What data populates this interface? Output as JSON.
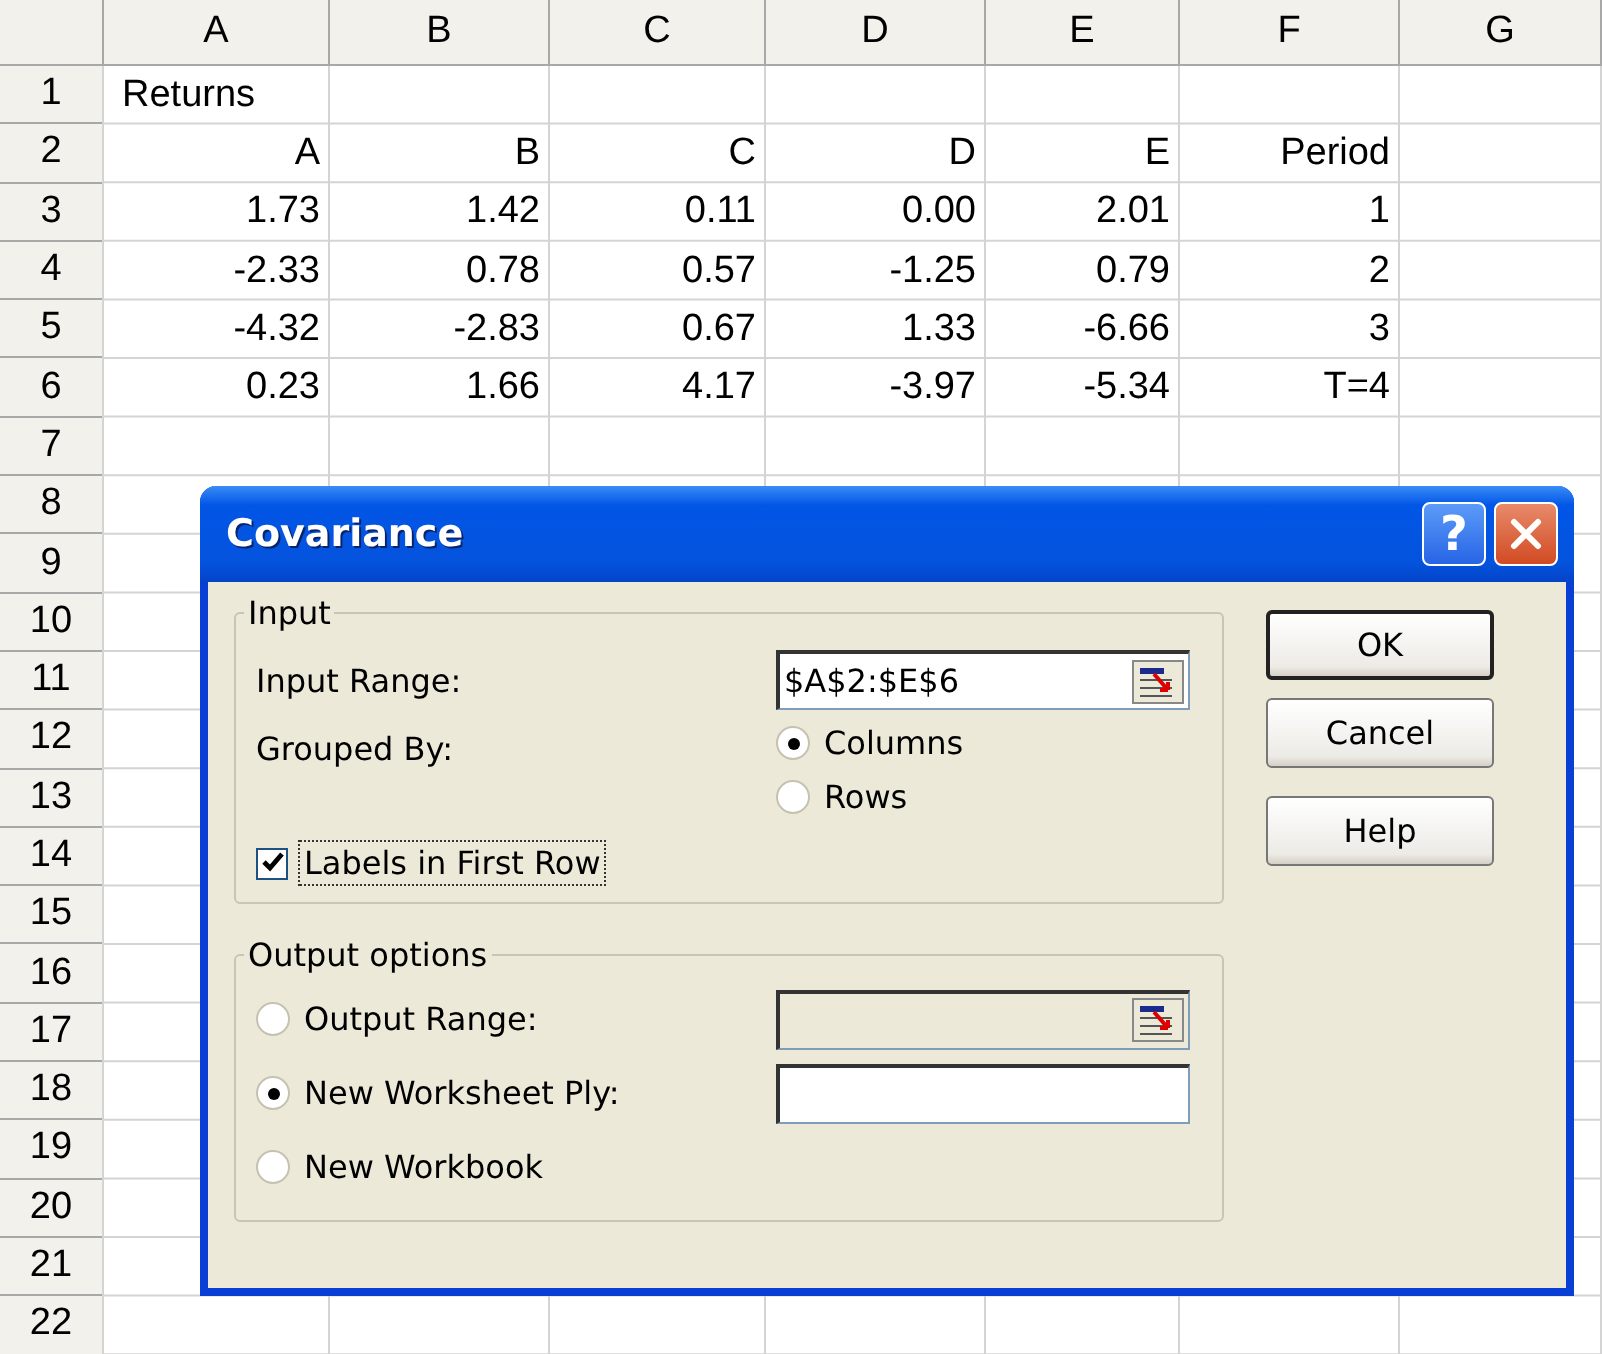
{
  "sheet": {
    "columns": [
      "A",
      "B",
      "C",
      "D",
      "E",
      "F",
      "G"
    ],
    "rows": [
      {
        "number": "1",
        "kind": "label",
        "cells": [
          "Returns"
        ]
      },
      {
        "number": "2",
        "kind": "data",
        "cells": [
          "A",
          "B",
          "C",
          "D",
          "E",
          "Period"
        ]
      },
      {
        "number": "3",
        "kind": "data",
        "cells": [
          "1.73",
          "1.42",
          "0.11",
          "0.00",
          "2.01",
          "1"
        ]
      },
      {
        "number": "4",
        "kind": "data",
        "cells": [
          "-2.33",
          "0.78",
          "0.57",
          "-1.25",
          "0.79",
          "2"
        ]
      },
      {
        "number": "5",
        "kind": "data",
        "cells": [
          "-4.32",
          "-2.83",
          "0.67",
          "1.33",
          "-6.66",
          "3"
        ]
      },
      {
        "number": "6",
        "kind": "data",
        "cells": [
          "0.23",
          "1.66",
          "4.17",
          "-3.97",
          "-5.34",
          "T=4"
        ]
      },
      {
        "number": "7"
      },
      {
        "number": "8"
      },
      {
        "number": "9"
      },
      {
        "number": "10"
      },
      {
        "number": "11"
      },
      {
        "number": "12"
      },
      {
        "number": "13"
      },
      {
        "number": "14"
      },
      {
        "number": "15"
      },
      {
        "number": "16"
      },
      {
        "number": "17"
      },
      {
        "number": "18"
      },
      {
        "number": "19"
      },
      {
        "number": "20"
      },
      {
        "number": "21"
      },
      {
        "number": "22"
      }
    ]
  },
  "dialog": {
    "title": "Covariance",
    "title_buttons": [
      {
        "kind": "help",
        "label": "?"
      },
      {
        "kind": "close"
      }
    ],
    "input_group": {
      "legend": "Input",
      "input_range": {
        "label": "Input Range:",
        "value": "$A$2:$E$6"
      },
      "grouped_by": {
        "label": "Grouped By:",
        "options": [
          {
            "label": "Columns",
            "selected": true
          },
          {
            "label": "Rows",
            "selected": false
          }
        ]
      },
      "labels_checkbox": {
        "label": "Labels in First Row",
        "checked": true,
        "focused": true
      }
    },
    "output_group": {
      "legend": "Output options",
      "options": [
        {
          "label": "Output Range:",
          "selected": false,
          "field": {
            "kind": "range",
            "disabled": true
          }
        },
        {
          "label": "New Worksheet Ply:",
          "selected": true,
          "field": {
            "kind": "text",
            "disabled": false
          }
        },
        {
          "label": "New Workbook",
          "selected": false
        }
      ]
    },
    "buttons": [
      {
        "label": "OK",
        "default": true
      },
      {
        "label": "Cancel",
        "default": false
      },
      {
        "label": "Help",
        "default": false
      }
    ]
  }
}
